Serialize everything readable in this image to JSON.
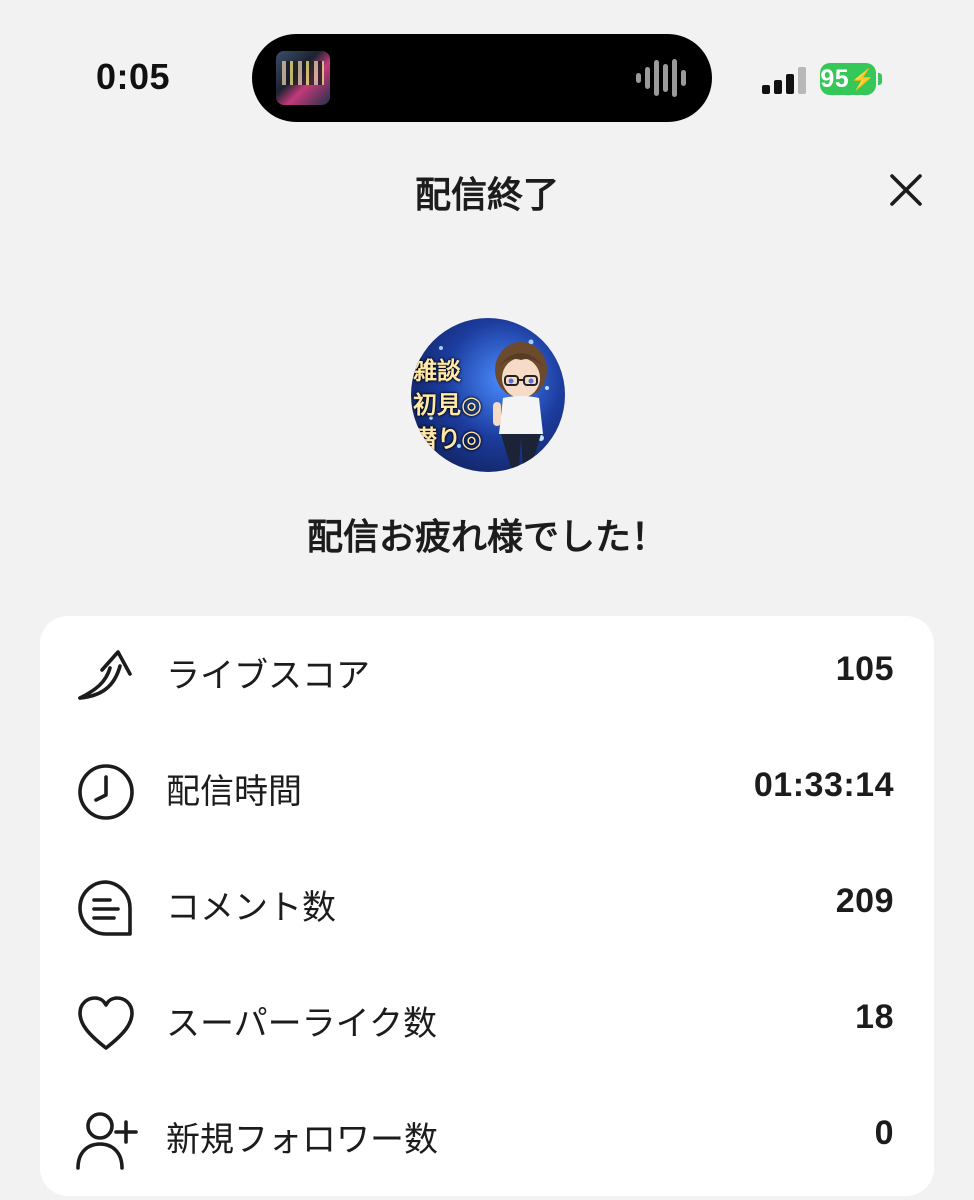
{
  "status_bar": {
    "time": "0:05",
    "battery": "95",
    "colors": {
      "battery": "#36c759"
    }
  },
  "header": {
    "title": "配信終了",
    "close_icon": "close-icon"
  },
  "profile": {
    "avatar_text": [
      "雑談",
      "初見◎",
      "潜り◎"
    ]
  },
  "message": "配信お疲れ様でした！",
  "stats": [
    {
      "icon": "live-score-arrow-icon",
      "label": "ライブスコア",
      "value": "105"
    },
    {
      "icon": "clock-icon",
      "label": "配信時間",
      "value": "01:33:14"
    },
    {
      "icon": "comment-icon",
      "label": "コメント数",
      "value": "209"
    },
    {
      "icon": "heart-icon",
      "label": "スーパーライク数",
      "value": "18"
    },
    {
      "icon": "add-follower-icon",
      "label": "新規フォロワー数",
      "value": "0"
    }
  ]
}
